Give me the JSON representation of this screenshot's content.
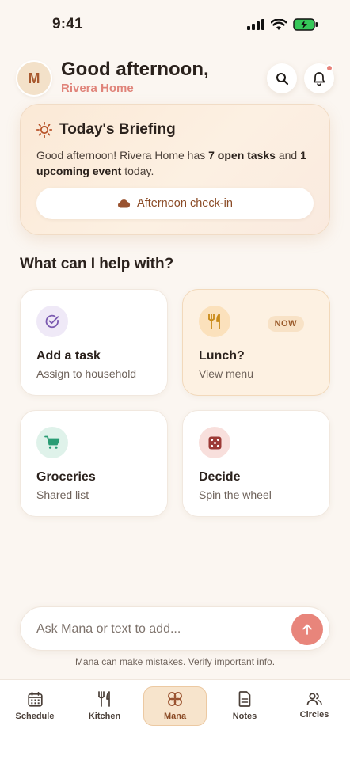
{
  "status_bar": {
    "time": "9:41"
  },
  "header": {
    "avatar_initial": "M",
    "greeting": "Good afternoon,",
    "household": "Rivera Home"
  },
  "briefing": {
    "title": "Today's Briefing",
    "text_1": "Good afternoon! Rivera Home has ",
    "open_tasks": "7 open tasks",
    "text_2": " and ",
    "upcoming": "1 upcoming event",
    "text_3": " today.",
    "checkin_label": "Afternoon check-in"
  },
  "help": {
    "heading": "What can I help with?",
    "tiles": [
      {
        "title": "Add a task",
        "subtitle": "Assign to household",
        "icon": "check-circle-icon",
        "icon_bg": "#efe9f7"
      },
      {
        "title": "Lunch?",
        "subtitle": "View menu",
        "badge": "NOW",
        "icon": "fork-knife-icon",
        "icon_bg": "#fbe1bc"
      },
      {
        "title": "Groceries",
        "subtitle": "Shared list",
        "icon": "cart-icon",
        "icon_bg": "#dff2ea"
      },
      {
        "title": "Decide",
        "subtitle": "Spin the wheel",
        "icon": "dice-icon",
        "icon_bg": "#f8dfdc"
      }
    ]
  },
  "ask": {
    "placeholder": "Ask Mana or text to add...",
    "disclaimer": "Mana can make mistakes. Verify important info."
  },
  "tabs": [
    {
      "label": "Schedule",
      "icon": "calendar-icon",
      "active": false
    },
    {
      "label": "Kitchen",
      "icon": "fork-knife-icon",
      "active": false
    },
    {
      "label": "Mana",
      "icon": "clover-icon",
      "active": true
    },
    {
      "label": "Notes",
      "icon": "document-icon",
      "active": false
    },
    {
      "label": "Circles",
      "icon": "people-icon",
      "active": false
    }
  ],
  "colors": {
    "accent": "#e8857b",
    "brand_brown": "#8a4a25",
    "background": "#fbf6f1"
  }
}
